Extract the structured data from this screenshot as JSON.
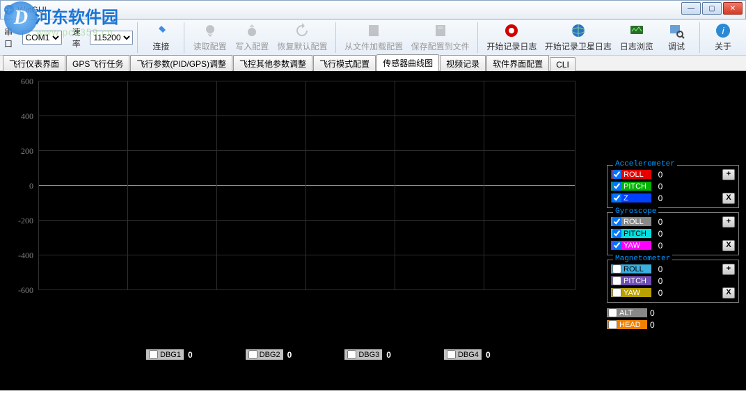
{
  "window": {
    "title": "WinGUI"
  },
  "watermark": {
    "brand": "河东软件园",
    "letter": "D",
    "url": "www.pc0359.cn"
  },
  "toolbar": {
    "port_label": "串口",
    "port_value": "COM1",
    "baud_label": "速率",
    "baud_value": "115200",
    "btn_connect": "连接",
    "btn_read": "读取配置",
    "btn_write": "写入配置",
    "btn_restore": "恢复默认配置",
    "btn_loadfile": "从文件加载配置",
    "btn_savefile": "保存配置到文件",
    "btn_log": "开始记录日志",
    "btn_satlog": "开始记录卫星日志",
    "btn_viewlog": "日志浏览",
    "btn_debug": "调试",
    "btn_about": "关于"
  },
  "tabs": {
    "items": [
      "飞行仪表界面",
      "GPS飞行任务",
      "飞行参数(PID/GPS)调整",
      "飞控其他参数调整",
      "飞行模式配置",
      "传感器曲线图",
      "视频记录",
      "软件界面配置",
      "CLI"
    ],
    "active": 5
  },
  "chart_data": {
    "type": "line",
    "title": "",
    "xlabel": "",
    "ylabel": "",
    "ylim": [
      -600,
      600
    ],
    "yticks": [
      600,
      400,
      200,
      0,
      -200,
      -400,
      -600
    ],
    "series": [
      {
        "name": "ACC ROLL",
        "values": []
      },
      {
        "name": "ACC PITCH",
        "values": []
      },
      {
        "name": "ACC Z",
        "values": []
      },
      {
        "name": "GYRO ROLL",
        "values": []
      },
      {
        "name": "GYRO PITCH",
        "values": []
      },
      {
        "name": "GYRO YAW",
        "values": []
      },
      {
        "name": "MAG ROLL",
        "values": []
      },
      {
        "name": "MAG PITCH",
        "values": []
      },
      {
        "name": "MAG YAW",
        "values": []
      }
    ]
  },
  "debug": {
    "items": [
      {
        "label": "DBG1",
        "value": "0"
      },
      {
        "label": "DBG2",
        "value": "0"
      },
      {
        "label": "DBG3",
        "value": "0"
      },
      {
        "label": "DBG4",
        "value": "0"
      }
    ]
  },
  "sensors": {
    "acc": {
      "title": "Accelerometer",
      "rows": [
        {
          "label": "ROLL",
          "value": "0",
          "checked": true
        },
        {
          "label": "PITCH",
          "value": "0",
          "checked": true
        },
        {
          "label": "Z",
          "value": "0",
          "checked": true
        }
      ],
      "btn_plus": "+",
      "btn_x": "X"
    },
    "gyro": {
      "title": "Gyroscope",
      "rows": [
        {
          "label": "ROLL",
          "value": "0",
          "checked": true
        },
        {
          "label": "PITCH",
          "value": "0",
          "checked": true
        },
        {
          "label": "YAW",
          "value": "0",
          "checked": true
        }
      ],
      "btn_plus": "+",
      "btn_x": "X"
    },
    "mag": {
      "title": "Magnetometer",
      "rows": [
        {
          "label": "ROLL",
          "value": "0",
          "checked": false
        },
        {
          "label": "PITCH",
          "value": "0",
          "checked": false
        },
        {
          "label": "YAW",
          "value": "0",
          "checked": false
        }
      ],
      "btn_plus": "+",
      "btn_x": "X"
    },
    "extra": [
      {
        "label": "ALT",
        "value": "0",
        "checked": false
      },
      {
        "label": "HEAD",
        "value": "0",
        "checked": false
      }
    ]
  }
}
